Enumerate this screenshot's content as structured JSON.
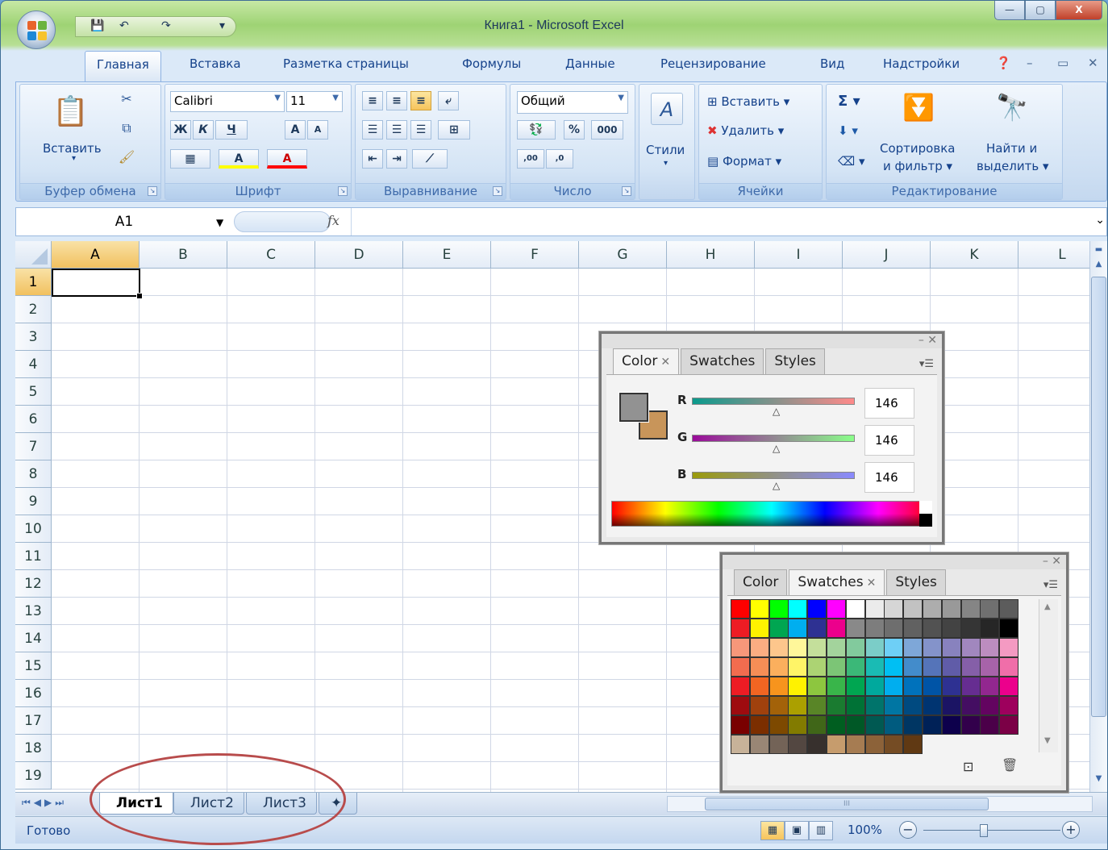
{
  "window": {
    "title": "Книга1 - Microsoft Excel",
    "controls": {
      "minimize": "—",
      "restore": "▢",
      "close": "X"
    }
  },
  "quick_access": {
    "save": "💾",
    "undo": "↶",
    "redo": "↷",
    "more": "▾"
  },
  "ribbon_tabs": [
    "Главная",
    "Вставка",
    "Разметка страницы",
    "Формулы",
    "Данные",
    "Рецензирование",
    "Вид",
    "Надстройки"
  ],
  "ribbon_tab_active": "Главная",
  "clipboard": {
    "paste": "Вставить",
    "label": "Буфер обмена"
  },
  "font": {
    "name": "Calibri",
    "size": "11",
    "bold": "Ж",
    "italic": "К",
    "underline": "Ч",
    "grow": "A",
    "shrink": "A",
    "fill": "A",
    "color": "A",
    "label": "Шрифт"
  },
  "alignment": {
    "label": "Выравнивание"
  },
  "number": {
    "format": "Общий",
    "percent": "%",
    "thousands": "000",
    "inc": ",00",
    "dec": ",0",
    "label": "Число"
  },
  "styles": {
    "label": "Стили"
  },
  "cells": {
    "insert": "Вставить",
    "delete": "Удалить",
    "format": "Формат",
    "label": "Ячейки"
  },
  "editing": {
    "sum": "Σ",
    "sort": "Сортировка",
    "sort2": "и фильтр",
    "find": "Найти и",
    "find2": "выделить",
    "label": "Редактирование"
  },
  "formula_bar": {
    "name_box": "A1",
    "fx": "fx",
    "value": ""
  },
  "columns": [
    "A",
    "B",
    "C",
    "D",
    "E",
    "F",
    "G",
    "H",
    "I",
    "J",
    "K",
    "L"
  ],
  "rows": [
    "1",
    "2",
    "3",
    "4",
    "5",
    "6",
    "7",
    "8",
    "9",
    "10",
    "11",
    "12",
    "13",
    "14",
    "15",
    "16",
    "17",
    "18",
    "19"
  ],
  "active_cell": "A1",
  "sheets": [
    "Лист1",
    "Лист2",
    "Лист3"
  ],
  "active_sheet": "Лист1",
  "status": {
    "ready": "Готово",
    "zoom": "100%"
  },
  "color_panel": {
    "tabs": [
      "Color",
      "Swatches",
      "Styles"
    ],
    "active_tab": "Color",
    "channels": [
      {
        "label": "R",
        "value": "146"
      },
      {
        "label": "G",
        "value": "146"
      },
      {
        "label": "B",
        "value": "146"
      }
    ],
    "foreground": "#929292",
    "background": "#c8955a"
  },
  "swatches_panel": {
    "tabs": [
      "Color",
      "Swatches",
      "Styles"
    ],
    "active_tab": "Swatches",
    "rows": [
      [
        "#ff0000",
        "#ffff00",
        "#00ff00",
        "#00ffff",
        "#0000ff",
        "#ff00ff",
        "#ffffff",
        "#ebebeb",
        "#d6d6d6",
        "#c2c2c2",
        "#adadad",
        "#999999",
        "#858585",
        "#707070",
        "#5c5c5c"
      ],
      [
        "#ed1c24",
        "#fff200",
        "#00a651",
        "#00aeef",
        "#2e3192",
        "#ec008c",
        "#898989",
        "#7d7d7d",
        "#6e6e6e",
        "#616161",
        "#525252",
        "#434343",
        "#353535",
        "#262626",
        "#000000"
      ],
      [
        "#f7977a",
        "#fbad82",
        "#fdc68c",
        "#fff79a",
        "#c4df9b",
        "#a3d39c",
        "#82ca9d",
        "#7bcdc8",
        "#6ecff6",
        "#7ea7d8",
        "#8493ca",
        "#8882be",
        "#a187be",
        "#bc8dbf",
        "#f49ac2"
      ],
      [
        "#f26c4f",
        "#f68e56",
        "#fbaf5d",
        "#fff467",
        "#acd373",
        "#7cc576",
        "#3bb878",
        "#1abbb4",
        "#00bff3",
        "#438ccb",
        "#5574b9",
        "#605ca8",
        "#855fa8",
        "#a763a9",
        "#f06ea9"
      ],
      [
        "#ed1c24",
        "#f26522",
        "#f7941d",
        "#fff200",
        "#8dc63f",
        "#39b54a",
        "#00a651",
        "#00a99d",
        "#00aeef",
        "#0072bc",
        "#0054a6",
        "#2e3192",
        "#662d91",
        "#92278f",
        "#ec008c"
      ],
      [
        "#9e0b0f",
        "#a0410d",
        "#a36209",
        "#aba000",
        "#598527",
        "#1a7b30",
        "#007236",
        "#00746b",
        "#0076a3",
        "#004a80",
        "#003471",
        "#1b1464",
        "#440e62",
        "#630460",
        "#9e005d"
      ],
      [
        "#790000",
        "#7b2e00",
        "#7d4900",
        "#827b00",
        "#406618",
        "#005e20",
        "#005826",
        "#005952",
        "#005b7f",
        "#003663",
        "#002157",
        "#0d004c",
        "#32004b",
        "#4b0049",
        "#7b0046"
      ],
      [
        "#c7b299",
        "#998675",
        "#736357",
        "#534741",
        "#37302d",
        "#c69c6d",
        "#a67c52",
        "#8c6239",
        "#754c24",
        "#603913",
        "#f3f3f3",
        "#f3f3f3",
        "#f3f3f3",
        "#f3f3f3",
        "#f3f3f3"
      ]
    ]
  }
}
